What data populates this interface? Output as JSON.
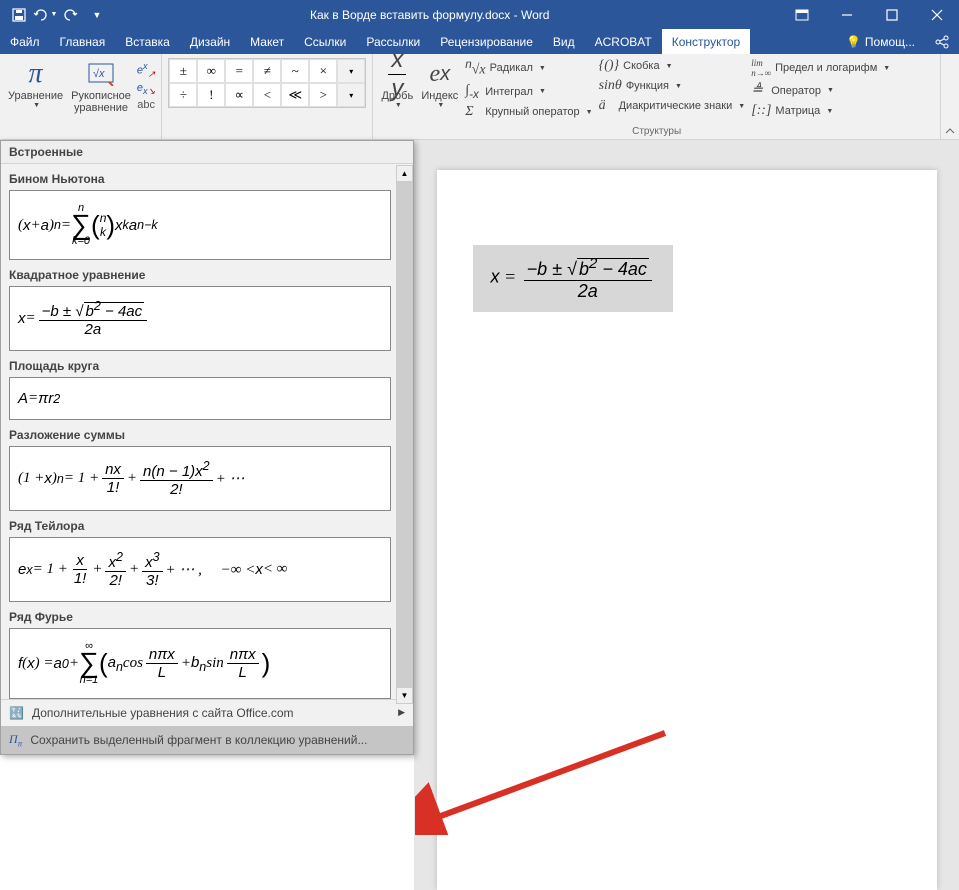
{
  "titlebar": {
    "title": "Как в Ворде вставить формулу.docx - Word"
  },
  "menu": {
    "file": "Файл",
    "home": "Главная",
    "insert": "Вставка",
    "design": "Дизайн",
    "layout": "Макет",
    "references": "Ссылки",
    "mailings": "Рассылки",
    "review": "Рецензирование",
    "view": "Вид",
    "acrobat": "ACROBAT",
    "constructor": "Конструктор",
    "help": "Помощ..."
  },
  "ribbon": {
    "equation": "Уравнение",
    "ink_equation": "Рукописное\nуравнение",
    "fraction": "Дробь",
    "index": "Индекс",
    "radical": "Радикал",
    "integral": "Интеграл",
    "large_operator": "Крупный оператор",
    "bracket": "Скобка",
    "function": "Функция",
    "diacritics": "Диакритические знаки",
    "limit_log": "Предел и логарифм",
    "operator": "Оператор",
    "matrix": "Матрица",
    "structures_label": "Структуры",
    "symbols": {
      "r1": [
        "±",
        "∞",
        "=",
        "≠",
        "~",
        "×",
        "▾"
      ],
      "r2": [
        "÷",
        "!",
        "∝",
        "<",
        "≪",
        ">",
        "▾"
      ]
    },
    "tools": {
      "prof": "e^x",
      "convert": "e_x",
      "abc": "abc"
    }
  },
  "dropdown": {
    "header": "Встроенные",
    "items": [
      {
        "label": "Бином Ньютона",
        "formula_html": "(<i>x</i> + <i>a</i>)<sup><i>n</i></sup> = <span class='sum'><span><i>n</i></span><span class='sigma'>∑</span><span><i>k</i>=0</span></span> <span class='paren-l'>(</span><span class='binom'><span><i>n</i></span><span><i>k</i></span></span><span class='paren-r'>)</span> <i>x</i><sup><i>k</i></sup><i>a</i><sup><i>n−k</i></sup>"
      },
      {
        "label": "Квадратное уравнение",
        "formula_html": "<i>x</i> = <span class='frac'><span class='num'>−<i>b</i> ± <span class='sqrt-sign'>√</span><span class='sqrt'><i>b</i><sup>2</sup> − 4<i>ac</i></span></span><span class='den'>2<i>a</i></span></span>"
      },
      {
        "label": "Площадь круга",
        "formula_html": "<i>A</i> = <i>πr</i><sup>2</sup>"
      },
      {
        "label": "Разложение суммы",
        "formula_html": "(1 + <i>x</i>)<sup><i>n</i></sup> = 1 + <span class='frac'><span class='num'><i>nx</i></span><span class='den'>1!</span></span> + <span class='frac'><span class='num'><i>n</i>(<i>n</i> − 1)<i>x</i><sup>2</sup></span><span class='den'>2!</span></span> + ⋯"
      },
      {
        "label": "Ряд Тейлора",
        "formula_html": "<i>e</i><sup><i>x</i></sup> = 1 + <span class='frac'><span class='num'><i>x</i></span><span class='den'>1!</span></span> + <span class='frac'><span class='num'><i>x</i><sup>2</sup></span><span class='den'>2!</span></span> + <span class='frac'><span class='num'><i>x</i><sup>3</sup></span><span class='den'>3!</span></span> + ⋯ ,&nbsp;&nbsp;&nbsp;&nbsp; −∞ &lt; <i>x</i> &lt; ∞"
      },
      {
        "label": "Ряд Фурье",
        "formula_html": "<i>f</i>(<i>x</i>) = <i>a</i><sub>0</sub> + <span class='sum'><span>∞</span><span class='sigma'>∑</span><span><i>n</i>=1</span></span> <span class='paren-l'>(</span><i>a<sub>n</sub></i> cos<span class='frac'><span class='num'><i>nπx</i></span><span class='den'><i>L</i></span></span> + <i>b<sub>n</sub></i> sin<span class='frac'><span class='num'><i>nπx</i></span><span class='den'><i>L</i></span></span><span class='paren-r'>)</span>"
      }
    ],
    "footer_more": "Дополнительные уравнения с сайта Office.com",
    "footer_save": "Сохранить выделенный фрагмент в коллекцию уравнений..."
  },
  "document": {
    "equation_html": "<i>x</i> = <span class='frac'><span class='num'>−<i>b</i> ± <span class='sqrt-sign'>√</span><span class='sqrt'><i>b</i><sup>2</sup> − 4<i>ac</i></span></span><span class='den'>2<i>a</i></span></span>"
  }
}
